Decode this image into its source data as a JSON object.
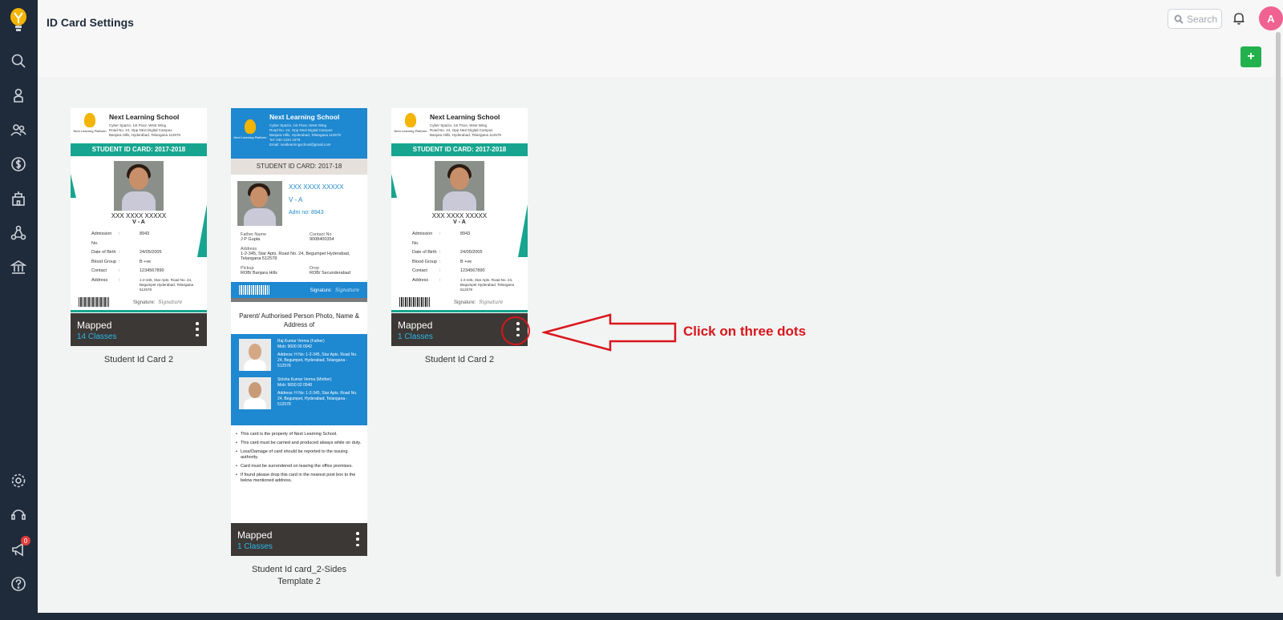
{
  "header": {
    "title": "ID Card Settings",
    "search_placeholder": "Search",
    "avatar_initial": "A",
    "add_label": "+"
  },
  "sidebar": {
    "notification_count": "0"
  },
  "cards": [
    {
      "school": "Next Learning School",
      "address": [
        "Cyber Spazio, 1st Floor, West Wing",
        "Road No. 24, Opp Next Digital Campus",
        "Banjara Hills, Hyderabad, Telangana 112578"
      ],
      "band": "STUDENT ID CARD: 2017-2018",
      "student_name": "XXX XXXX XXXXX",
      "student_class": "V - A",
      "fields": [
        {
          "k": "Admission No.",
          "v": "8943"
        },
        {
          "k": "Date of Birth",
          "v": "24/05/2005"
        },
        {
          "k": "Blood Group",
          "v": "B +ve"
        },
        {
          "k": "Contact",
          "v": "1234567890"
        }
      ],
      "address_label": "Address",
      "student_address": "1-2-345, Star Apts. Road No. 24, Begumpet Hyderabad, Telangana 512578",
      "signature_label": "Signature:",
      "signature": "Signature",
      "status": "Mapped",
      "classes": "14 Classes",
      "caption": "Student Id Card 2"
    },
    {
      "school": "Next Learning School",
      "address": [
        "Cyber Spazio, 1st Floor, West Wing",
        "Road No. 24, Opp Next Digital Campus",
        "Banjara Hills, Hyderabad, Telangana 112578",
        "Tel: 040 1234 1678",
        "Email: nextlearningschool@gmail.com"
      ],
      "band": "STUDENT ID CARD: 2017-18",
      "student_name": "XXX XXXX XXXXX",
      "student_class": "V - A",
      "adm": "Adm no: 8943",
      "father_label": "Father Name",
      "father": "J P Gupta",
      "contact_label": "Contact No",
      "contact": "9008400354",
      "address_label": "Address",
      "student_address": "1-2-345, Star Apts.  Road No. 24, Begumpet Hyderabad, Telangana 512578",
      "pickup_label": "Pickup",
      "pickup": "ROB/ Banjara Hills",
      "drop_label": "Drop",
      "drop": "ROB/ Secunderabad",
      "signature_label": "Signature:",
      "signature": "Signature",
      "back_title": "Parent/ Authorised Person Photo, Name & Address of",
      "parents": [
        {
          "name": "Raj Kumar Verma (Father)",
          "mob": "Mob: 9600 00 0042",
          "addr": "Address: H No: 1-2-345, Star Apts. Road No. 24, Begumpet, Hyderabad, Telangana - 512578"
        },
        {
          "name": "Sirisha Kumar Verma (Mother)",
          "mob": "Mob: 9650 02 0548",
          "addr": "Address: H No: 1-2-345, Star Apts. Road No. 24, Begumpet, Hyderabad, Telangana - 512578"
        }
      ],
      "rules": [
        "This card is the property of Next Learning School.",
        "This card must be carried and produced always while on duty.",
        "Loss/Damage of card should be reported to the issuing authority.",
        "Card must be surrendered on leaving the office premises.",
        "If found please drop this card in the nearest post box to the below mentioned address."
      ],
      "status": "Mapped",
      "classes": "1 Classes",
      "caption_line1": "Student Id card_2-Sides",
      "caption_line2": "Template 2"
    },
    {
      "school": "Next Learning School",
      "address": [
        "Cyber Spazio, 1st Floor, West Wing",
        "Road No. 24, Opp Next Digital Campus",
        "Banjara Hills, Hyderabad, Telangana 112578"
      ],
      "band": "STUDENT ID CARD: 2017-2018",
      "student_name": "XXX XXXX XXXXX",
      "student_class": "V - A",
      "fields": [
        {
          "k": "Admission No.",
          "v": "8943"
        },
        {
          "k": "Date of Birth",
          "v": "24/05/2005"
        },
        {
          "k": "Blood Group",
          "v": "B +ve"
        },
        {
          "k": "Contact",
          "v": "1234567890"
        }
      ],
      "address_label": "Address",
      "student_address": "1-2-345, Star Apts. Road No. 24, Begumpet Hyderabad, Telangana 512578",
      "signature_label": "Signature:",
      "signature": "Signature",
      "status": "Mapped",
      "classes": "1 Classes",
      "caption": "Student Id Card 2"
    }
  ],
  "annotation": {
    "text": "Click on three dots"
  },
  "colors": {
    "sidebar": "#1f2b3a",
    "teal": "#17a58f",
    "blue": "#1e88d0",
    "accent_green": "#22b14c",
    "annotation_red": "#d9161c"
  }
}
